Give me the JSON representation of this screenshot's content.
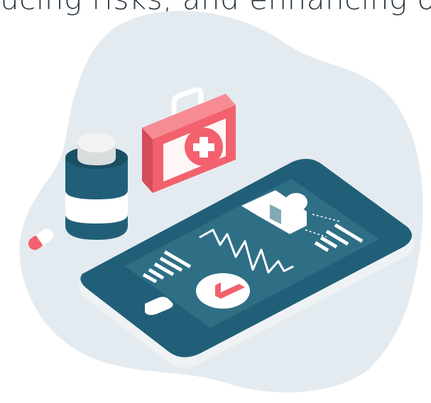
{
  "headline": {
    "text": "ucing risks, and enhancing o"
  },
  "colors": {
    "blob": "#e4ebf0",
    "tablet_dark": "#215f78",
    "tablet_shadow": "#eef2f4",
    "screen": "#2f6f85",
    "coral": "#f2616d",
    "white": "#ffffff",
    "bottle_cap": "#eeeeee"
  },
  "icons": [
    "medical-kit-icon",
    "medicine-bottle-icon",
    "pill-capsule-icon",
    "tablet-device-icon",
    "user-profile-icon",
    "heartbeat-line-icon",
    "clock-icon",
    "bar-chart-icon"
  ]
}
